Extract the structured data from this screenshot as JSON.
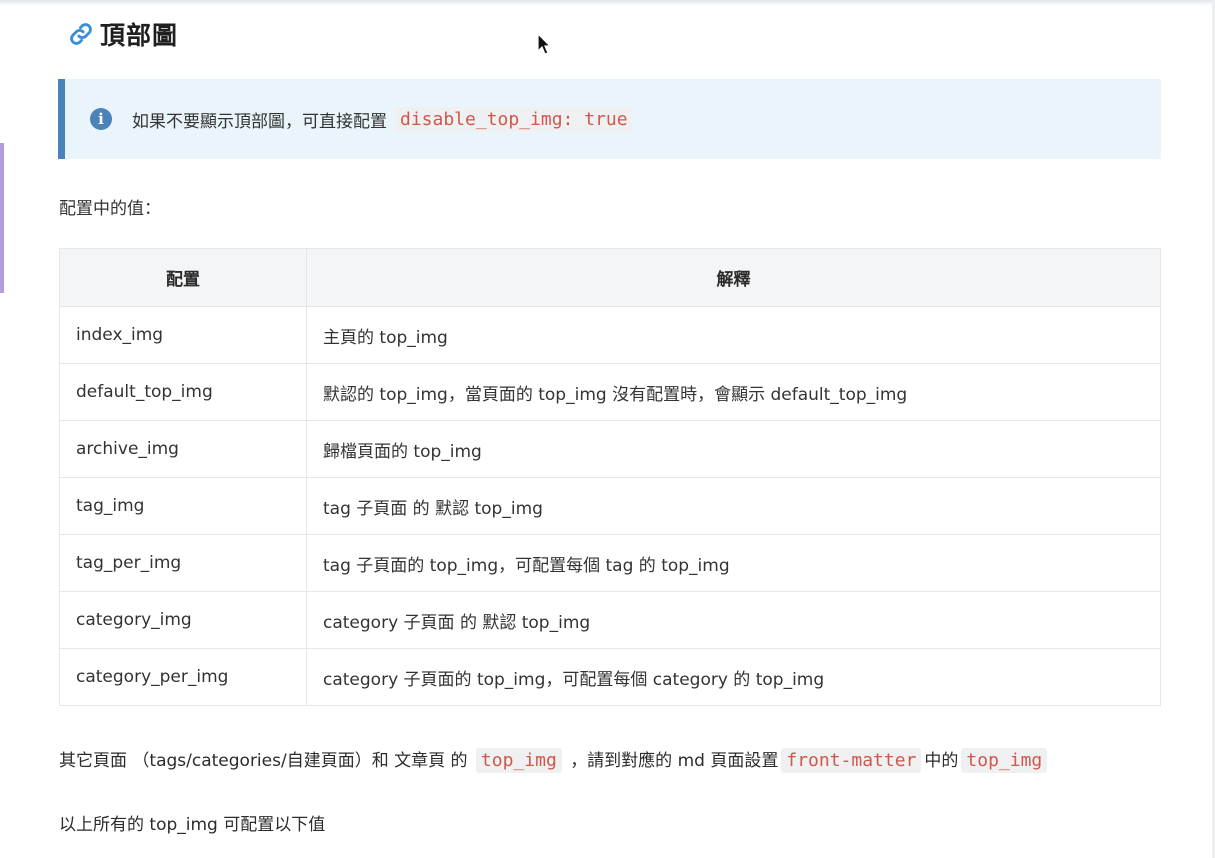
{
  "heading": {
    "icon": "link-icon",
    "title": "頂部圖"
  },
  "note": {
    "icon": "info-icon",
    "text": "如果不要顯示頂部圖，可直接配置",
    "code": "disable_top_img: true"
  },
  "config_label": "配置中的值：",
  "table": {
    "headers": [
      "配置",
      "解釋"
    ],
    "rows": [
      {
        "key": "index_img",
        "desc": "主頁的 top_img"
      },
      {
        "key": "default_top_img",
        "desc": "默認的 top_img，當頁面的 top_img 沒有配置時，會顯示 default_top_img"
      },
      {
        "key": "archive_img",
        "desc": "歸檔頁面的 top_img"
      },
      {
        "key": "tag_img",
        "desc": "tag 子頁面 的 默認 top_img"
      },
      {
        "key": "tag_per_img",
        "desc": "tag 子頁面的 top_img，可配置每個 tag 的 top_img"
      },
      {
        "key": "category_img",
        "desc": "category 子頁面 的 默認 top_img"
      },
      {
        "key": "category_per_img",
        "desc": "category 子頁面的 top_img，可配置每個 category 的 top_img"
      }
    ]
  },
  "paragraph1": {
    "part1": "其它頁面 （tags/categories/自建頁面）和 文章頁 的",
    "code1": "top_img",
    "part2": "，請到對應的 md 頁面設置",
    "code2": "front-matter",
    "part3": "中的",
    "code3": "top_img"
  },
  "paragraph2": "以上所有的 top_img 可配置以下值",
  "colors": {
    "accent": "#4a82b9",
    "note_background": "#eaf5fb",
    "code_text": "#d0584b",
    "code_background": "#eef0f2",
    "table_header_background": "#f4f5f6"
  }
}
